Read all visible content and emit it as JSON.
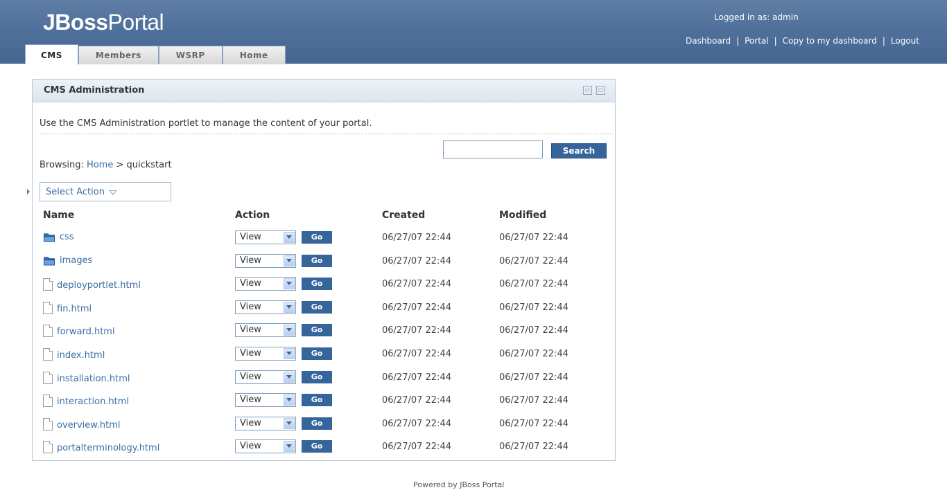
{
  "header": {
    "logo_bold": "JBoss",
    "logo_thin": "Portal",
    "logged_in": "Logged in as: admin",
    "links": [
      "Dashboard",
      "Portal",
      "Copy to my dashboard",
      "Logout"
    ]
  },
  "tabs": [
    {
      "label": "CMS",
      "active": true
    },
    {
      "label": "Members",
      "active": false
    },
    {
      "label": "WSRP",
      "active": false
    },
    {
      "label": "Home",
      "active": false
    }
  ],
  "portlet": {
    "title": "CMS Administration",
    "intro": "Use the CMS Administration portlet to manage the content of your portal.",
    "search_button": "Search",
    "search_value": "",
    "breadcrumb_prefix": "Browsing: ",
    "breadcrumb_home": "Home",
    "breadcrumb_rest": " > quickstart",
    "select_action": "Select Action",
    "columns": {
      "name": "Name",
      "action": "Action",
      "created": "Created",
      "modified": "Modified"
    },
    "action_default": "View",
    "go_label": "Go",
    "rows": [
      {
        "name": "css",
        "type": "folder",
        "created": "06/27/07 22:44",
        "modified": "06/27/07 22:44"
      },
      {
        "name": "images",
        "type": "folder",
        "created": "06/27/07 22:44",
        "modified": "06/27/07 22:44"
      },
      {
        "name": "deployportlet.html",
        "type": "file",
        "created": "06/27/07 22:44",
        "modified": "06/27/07 22:44"
      },
      {
        "name": "fin.html",
        "type": "file",
        "created": "06/27/07 22:44",
        "modified": "06/27/07 22:44"
      },
      {
        "name": "forward.html",
        "type": "file",
        "created": "06/27/07 22:44",
        "modified": "06/27/07 22:44"
      },
      {
        "name": "index.html",
        "type": "file",
        "created": "06/27/07 22:44",
        "modified": "06/27/07 22:44"
      },
      {
        "name": "installation.html",
        "type": "file",
        "created": "06/27/07 22:44",
        "modified": "06/27/07 22:44"
      },
      {
        "name": "interaction.html",
        "type": "file",
        "created": "06/27/07 22:44",
        "modified": "06/27/07 22:44"
      },
      {
        "name": "overview.html",
        "type": "file",
        "created": "06/27/07 22:44",
        "modified": "06/27/07 22:44"
      },
      {
        "name": "portalterminology.html",
        "type": "file",
        "created": "06/27/07 22:44",
        "modified": "06/27/07 22:44"
      }
    ]
  },
  "footer": "Powered by JBoss Portal",
  "colors": {
    "header": "#4e6f9a",
    "link": "#3a6ea5",
    "button": "#36659c"
  }
}
